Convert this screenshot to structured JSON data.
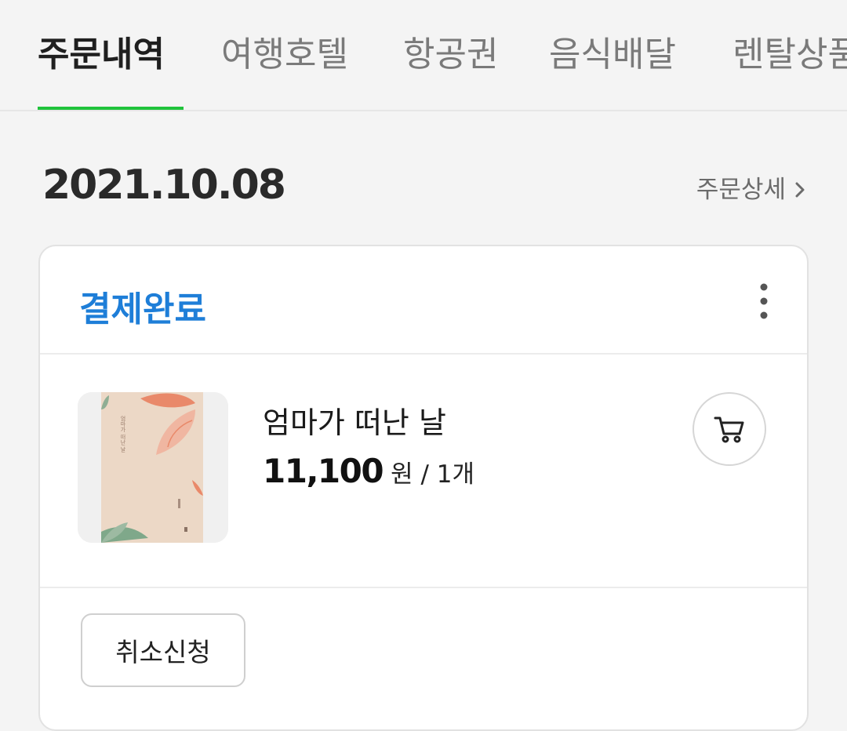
{
  "tabs": [
    {
      "label": "주문내역",
      "active": true
    },
    {
      "label": "여행호텔",
      "active": false
    },
    {
      "label": "항공권",
      "active": false
    },
    {
      "label": "음식배달",
      "active": false
    },
    {
      "label": "렌탈상품",
      "active": false
    }
  ],
  "order": {
    "date": "2021.10.08",
    "detail_link": "주문상세",
    "status": "결제완료",
    "item": {
      "title": "엄마가 떠난 날",
      "price": "11,100",
      "unit": "원 / 1개",
      "cover_title": "엄마가 떠난 날"
    },
    "cancel_label": "취소신청"
  },
  "colors": {
    "accent_green": "#20c33b",
    "status_blue": "#1e7ed8",
    "background": "#f4f4f4"
  },
  "icons": [
    "chevron-right-icon",
    "more-vertical-icon",
    "cart-icon"
  ]
}
